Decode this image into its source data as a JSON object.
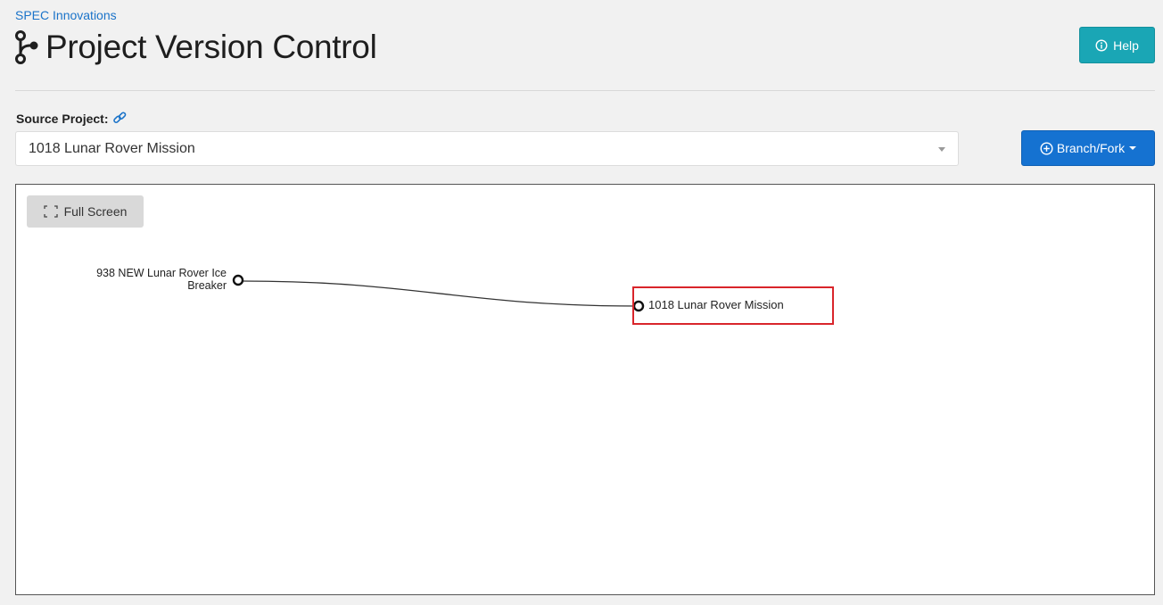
{
  "breadcrumb": "SPEC Innovations",
  "header": {
    "title": "Project Version Control",
    "icon": "branch-icon",
    "help_label": "Help",
    "help_icon": "info-circle-icon"
  },
  "source": {
    "label": "Source Project:",
    "link_icon": "link-icon",
    "selected_project": "1018 Lunar Rover Mission"
  },
  "actions": {
    "branch_label": "Branch/Fork",
    "branch_icon": "plus-circle-icon"
  },
  "graph": {
    "fullscreen_label": "Full Screen",
    "nodes": [
      {
        "id": "938",
        "label": "938 NEW Lunar Rover Ice Breaker",
        "role": "parent"
      },
      {
        "id": "1018",
        "label": "1018 Lunar Rover Mission",
        "role": "current",
        "highlighted": true
      }
    ],
    "edges": [
      {
        "from": "938",
        "to": "1018"
      }
    ]
  },
  "colors": {
    "link": "#1a73c9",
    "help_button": "#1aa6b5",
    "branch_button": "#1572d1",
    "highlight": "#d9252b",
    "page_background": "#f1f1f1"
  }
}
